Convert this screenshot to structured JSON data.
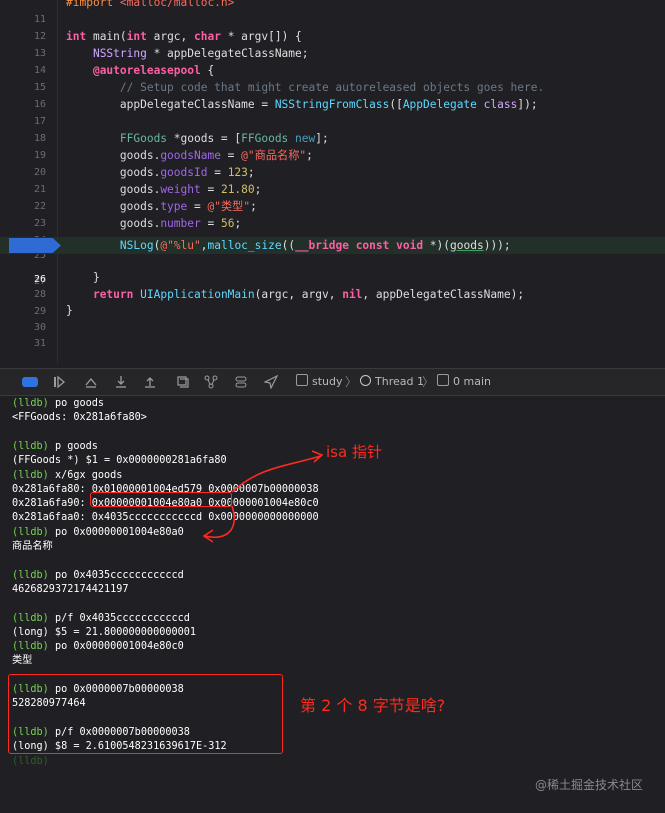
{
  "editor": {
    "lines": [
      {
        "n": "11",
        "y": 0
      },
      {
        "n": "12",
        "y": 0
      },
      {
        "n": "13",
        "y": 0
      },
      {
        "n": "14",
        "y": 0
      },
      {
        "n": "15",
        "y": 0
      },
      {
        "n": "16",
        "y": 0
      },
      {
        "n": "17",
        "y": 0
      },
      {
        "n": "18",
        "y": 0
      },
      {
        "n": "19",
        "y": 0
      },
      {
        "n": "20",
        "y": 0
      },
      {
        "n": "21",
        "y": 0
      },
      {
        "n": "22",
        "y": 0
      },
      {
        "n": "23",
        "y": 0
      },
      {
        "n": "24",
        "y": 0
      },
      {
        "n": "25",
        "y": 0
      },
      {
        "n": "26",
        "y": 0
      },
      {
        "n": "27",
        "y": 0
      },
      {
        "n": "28",
        "y": 0
      },
      {
        "n": "29",
        "y": 0
      },
      {
        "n": "30",
        "y": 0
      },
      {
        "n": "31",
        "y": 0
      }
    ],
    "t": {
      "l11a": "#import ",
      "l11b": "<malloc/malloc.h>",
      "l13_int": "int",
      "l13_main": " main(",
      "l13_int2": "int",
      "l13_argc": " argc, ",
      "l13_char": "char",
      "l13_rest": " * argv[]) {",
      "l14_ns": "NSString",
      "l14_rest": " * appDelegateClassName;",
      "l15_kw": "@autoreleasepool",
      "l15_rest": " {",
      "l16": "// Setup code that might create autoreleased objects goes here.",
      "l17_a": "appDelegateClassName = ",
      "l17_fn": "NSStringFromClass",
      "l17_b": "([",
      "l17_cls": "AppDelegate",
      "l17_sp": " ",
      "l17_class": "class",
      "l17_c": "]);",
      "l19_a": "FFGoods",
      "l19_b": " *goods = [",
      "l19_c": "FFGoods",
      "l19_d": " ",
      "l19_e": "new",
      "l19_f": "];",
      "l20_a": "goods.",
      "l20_p": "goodsName",
      "l20_b": " = ",
      "l20_s": "@\"商品名称\"",
      "l20_c": ";",
      "l21_a": "goods.",
      "l21_p": "goodsId",
      "l21_b": " = ",
      "l21_n": "123",
      "l21_c": ";",
      "l22_a": "goods.",
      "l22_p": "weight",
      "l22_b": " = ",
      "l22_n": "21.80",
      "l22_c": ";",
      "l23_a": "goods.",
      "l23_p": "type",
      "l23_b": " = ",
      "l23_s": "@\"类型\"",
      "l23_c": ";",
      "l24_a": "goods.",
      "l24_p": "number",
      "l24_b": " = ",
      "l24_n": "56",
      "l24_c": ";",
      "l26_fn": "NSLog",
      "l26_a": "(",
      "l26_s": "@\"%lu\"",
      "l26_b": ",",
      "l26_fn2": "malloc_size",
      "l26_c": "((",
      "l26_kw": "__bridge const void",
      "l26_d": " *)(",
      "l26_g": "goods",
      "l26_e": ")));",
      "l28": "}",
      "l29_kw": "return",
      "l29_sp": " ",
      "l29_fn": "UIApplicationMain",
      "l29_a": "(argc, argv, ",
      "l29_nil": "nil",
      "l29_b": ", appDelegateClassName);",
      "l30": "}"
    }
  },
  "debugbar": {
    "colors": {
      "accent": "#2f73e0"
    },
    "icons": [
      "breakpoints-toggle-icon",
      "continue-icon",
      "step-over-icon",
      "step-into-icon",
      "step-out-icon",
      "view-hierarchy-icon",
      "memory-graph-icon",
      "environment-overrides-icon",
      "location-icon"
    ],
    "crumb_app": "study",
    "crumb_thread": "Thread 1",
    "crumb_frame": "0 main"
  },
  "console": {
    "lines": [
      {
        "prompt": "(lldb)",
        "text": " po goods"
      },
      {
        "prompt": "",
        "text": "<FFGoods: 0x281a6fa80>"
      },
      {
        "prompt": "",
        "text": ""
      },
      {
        "prompt": "(lldb)",
        "text": " p goods"
      },
      {
        "prompt": "",
        "text": "(FFGoods *) $1 = 0x0000000281a6fa80"
      },
      {
        "prompt": "(lldb)",
        "text": " x/6gx goods"
      },
      {
        "prompt": "",
        "text": "0x281a6fa80: 0x01000001004ed579 0x0000007b00000038"
      },
      {
        "prompt": "",
        "text": "0x281a6fa90: 0x00000001004e80a0 0x00000001004e80c0"
      },
      {
        "prompt": "",
        "text": "0x281a6faa0: 0x4035cccccccccccd 0x0000000000000000"
      },
      {
        "prompt": "(lldb)",
        "text": " po 0x00000001004e80a0"
      },
      {
        "prompt": "",
        "text": "商品名称"
      },
      {
        "prompt": "",
        "text": ""
      },
      {
        "prompt": "(lldb)",
        "text": " po 0x4035cccccccccccd"
      },
      {
        "prompt": "",
        "text": "4626829372174421197"
      },
      {
        "prompt": "",
        "text": ""
      },
      {
        "prompt": "(lldb)",
        "text": " p/f 0x4035cccccccccccd"
      },
      {
        "prompt": "",
        "text": "(long) $5 = 21.800000000000001"
      },
      {
        "prompt": "(lldb)",
        "text": " po 0x00000001004e80c0"
      },
      {
        "prompt": "",
        "text": "类型"
      },
      {
        "prompt": "",
        "text": ""
      },
      {
        "prompt": "(lldb)",
        "text": " po 0x0000007b00000038"
      },
      {
        "prompt": "",
        "text": "528280977464"
      },
      {
        "prompt": "",
        "text": ""
      },
      {
        "prompt": "(lldb)",
        "text": " p/f 0x0000007b00000038"
      },
      {
        "prompt": "",
        "text": "(long) $8 = 2.6100548231639617E-312"
      },
      {
        "prompt": "(lldb)",
        "text": ""
      }
    ]
  },
  "annotations": {
    "isa_label": "isa 指针",
    "question_label": "第 2 个 8 字节是啥?",
    "color": "#ff2a1f"
  },
  "watermark": "@稀土掘金技术社区"
}
